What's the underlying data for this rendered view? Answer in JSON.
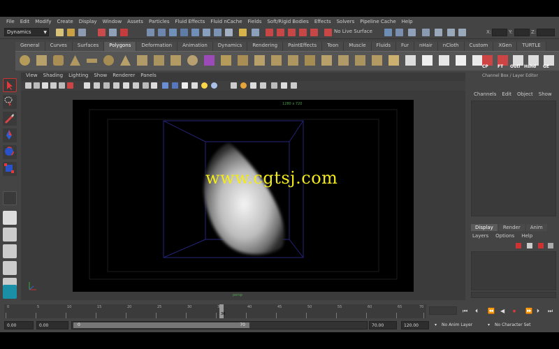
{
  "menu": [
    "File",
    "Edit",
    "Modify",
    "Create",
    "Display",
    "Window",
    "Assets",
    "Particles",
    "Fluid Effects",
    "Fluid nCache",
    "Fields",
    "Soft/Rigid Bodies",
    "Effects",
    "Solvers",
    "Pipeline Cache",
    "Help"
  ],
  "status_line": {
    "mode": "Dynamics",
    "live_surface": "No Live Surface",
    "x_label": "X:",
    "y_label": "Y:",
    "z_label": "Z:"
  },
  "shelf": {
    "tabs": [
      "General",
      "Curves",
      "Surfaces",
      "Polygons",
      "Deformation",
      "Animation",
      "Dynamics",
      "Rendering",
      "PaintEffects",
      "Toon",
      "Muscle",
      "Fluids",
      "Fur",
      "nHair",
      "nCloth",
      "Custom",
      "XGen",
      "TURTLE"
    ],
    "active_tab": "Polygons",
    "text_buttons": [
      "CP",
      "FT",
      "Outl",
      "Hshd",
      "GE"
    ]
  },
  "panel": {
    "menu": [
      "View",
      "Shading",
      "Lighting",
      "Show",
      "Renderer",
      "Panels"
    ],
    "resolution": "1280 x 720",
    "camera": "persp"
  },
  "watermark": "www.cgtsj.com",
  "channel_box": {
    "title": "Channel Box / Layer Editor",
    "menu": [
      "Channels",
      "Edit",
      "Object",
      "Show"
    ]
  },
  "layer_editor": {
    "tabs": [
      "Display",
      "Render",
      "Anim"
    ],
    "active_tab": "Display",
    "menu": [
      "Layers",
      "Options",
      "Help"
    ]
  },
  "time_slider": {
    "ticks": [
      "0",
      "5",
      "10",
      "15",
      "20",
      "25",
      "30",
      "35",
      "40",
      "45",
      "50",
      "55",
      "60",
      "65",
      "70"
    ],
    "current_frame": "36"
  },
  "range_slider": {
    "start_time": "0.00",
    "playback_start": "0.00",
    "range_min": "0",
    "range_max": "70",
    "playback_end": "70.00",
    "end_time": "120.00",
    "anim_layer": "No Anim Layer",
    "character_set": "No Character Set"
  },
  "colors": {
    "accent_yellow": "#f2ea1a",
    "ui_bg": "#444444",
    "viewport_bg": "#000000",
    "grid_blue": "#2a2a8a"
  }
}
